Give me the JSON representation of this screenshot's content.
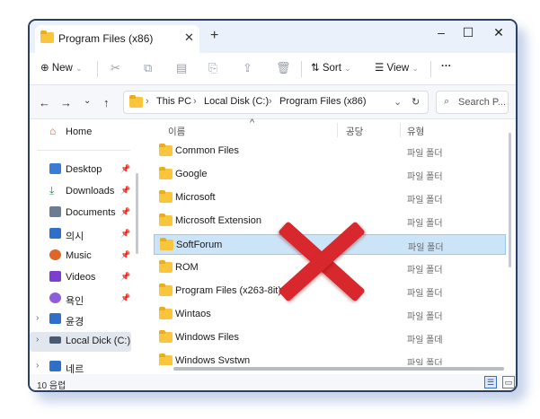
{
  "tab": {
    "title": "Program Files (x86)",
    "close": "✕",
    "new": "+"
  },
  "window_controls": {
    "minimize": "–",
    "maximize": "☐",
    "close": "✕"
  },
  "toolbar": {
    "new_label": "New",
    "sort_label": "Sort",
    "view_label": "View",
    "more_label": "···",
    "icons": [
      "cut-icon",
      "copy-icon",
      "paste-icon",
      "rename-icon",
      "share-icon",
      "delete-icon"
    ]
  },
  "address": {
    "crumbs": [
      "This PC",
      "Local Disk (C:)",
      "Program Files (x86)"
    ],
    "search_placeholder": "Search P..."
  },
  "sidebar": {
    "home": "Home",
    "quick": [
      {
        "label": "Desktop",
        "icon": "desktop-icon",
        "color": "#3a7bd5"
      },
      {
        "label": "Downloads",
        "icon": "download-icon",
        "color": "#2f8a4a"
      },
      {
        "label": "Documents",
        "icon": "documents-icon",
        "color": "#6b7c93"
      },
      {
        "label": "의시",
        "icon": "pictures-icon",
        "color": "#2f6fc9"
      },
      {
        "label": "Music",
        "icon": "music-icon",
        "color": "#e0652a"
      },
      {
        "label": "Videos",
        "icon": "videos-icon",
        "color": "#7a3fd1"
      },
      {
        "label": "욕인",
        "icon": "recent-icon",
        "color": "#8c5fd8"
      }
    ],
    "tree": [
      {
        "label": "윤경",
        "icon": "this-pc-icon",
        "color": "#2f6fc9"
      },
      {
        "label": "Local Dick (C:)",
        "icon": "drive-icon",
        "color": "#4a5a70"
      },
      {
        "label": "네르",
        "icon": "network-icon",
        "color": "#2f6fc9"
      }
    ]
  },
  "columns": {
    "name": "이름",
    "date": "공당",
    "type": "유형"
  },
  "files": [
    {
      "name": "Common Files",
      "type": "파일 폴더"
    },
    {
      "name": "Google",
      "type": "파일 폴터"
    },
    {
      "name": "Microsoft",
      "type": "파일 폴더"
    },
    {
      "name": "Microsoft Extension",
      "type": "파일 폴더"
    },
    {
      "name": "SoftForum",
      "type": "파일 폴더",
      "selected": true
    },
    {
      "name": "ROM",
      "type": "파일 폴더"
    },
    {
      "name": "Program Files (x263-8it)",
      "type": "파일 폴더"
    },
    {
      "name": "Wintaos",
      "type": "파일 폴더"
    },
    {
      "name": "Windows Files",
      "type": "파일 폴데"
    },
    {
      "name": "Windows Svstwn",
      "type": "파일 폴더"
    }
  ],
  "status": {
    "count": "10 음렵"
  },
  "overlay": {
    "mark": "red-x",
    "color": "#d8272d"
  }
}
